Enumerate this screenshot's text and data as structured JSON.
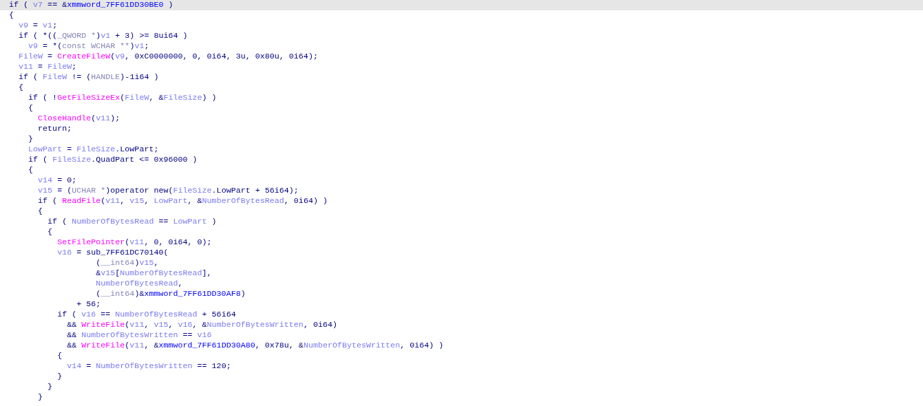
{
  "pseudocode": {
    "lines": [
      {
        "selected": true,
        "tokens": [
          {
            "kind": "k",
            "text": "if ( "
          },
          {
            "kind": "v",
            "text": "v7"
          },
          {
            "kind": "k",
            "text": " == &"
          },
          {
            "kind": "g",
            "text": "xmmword_7FF61DD30BE0"
          },
          {
            "kind": "k",
            "text": " )"
          }
        ]
      },
      {
        "selected": false,
        "tokens": [
          {
            "kind": "k",
            "text": "{"
          }
        ]
      },
      {
        "selected": false,
        "tokens": [
          {
            "kind": "v",
            "text": "  v9"
          },
          {
            "kind": "k",
            "text": " = "
          },
          {
            "kind": "v",
            "text": "v1"
          },
          {
            "kind": "k",
            "text": ";"
          }
        ]
      },
      {
        "selected": false,
        "tokens": [
          {
            "kind": "k",
            "text": "  if ( *(("
          },
          {
            "kind": "t",
            "text": "_QWORD *"
          },
          {
            "kind": "k",
            "text": ")"
          },
          {
            "kind": "v",
            "text": "v1"
          },
          {
            "kind": "k",
            "text": " + 3) >= 8ui64 )"
          }
        ]
      },
      {
        "selected": false,
        "tokens": [
          {
            "kind": "v",
            "text": "    v9"
          },
          {
            "kind": "k",
            "text": " = *("
          },
          {
            "kind": "t",
            "text": "const WCHAR **"
          },
          {
            "kind": "k",
            "text": ")"
          },
          {
            "kind": "v",
            "text": "v1"
          },
          {
            "kind": "k",
            "text": ";"
          }
        ]
      },
      {
        "selected": false,
        "tokens": [
          {
            "kind": "v",
            "text": "  FileW"
          },
          {
            "kind": "k",
            "text": " = "
          },
          {
            "kind": "f",
            "text": "CreateFileW"
          },
          {
            "kind": "k",
            "text": "("
          },
          {
            "kind": "v",
            "text": "v9"
          },
          {
            "kind": "k",
            "text": ", 0xC0000000, 0, 0i64, 3u, 0x80u, 0i64);"
          }
        ]
      },
      {
        "selected": false,
        "tokens": [
          {
            "kind": "v",
            "text": "  v11"
          },
          {
            "kind": "k",
            "text": " = "
          },
          {
            "kind": "v",
            "text": "FileW"
          },
          {
            "kind": "k",
            "text": ";"
          }
        ]
      },
      {
        "selected": false,
        "tokens": [
          {
            "kind": "k",
            "text": "  if ( "
          },
          {
            "kind": "v",
            "text": "FileW"
          },
          {
            "kind": "k",
            "text": " != ("
          },
          {
            "kind": "t",
            "text": "HANDLE"
          },
          {
            "kind": "k",
            "text": ")-1i64 )"
          }
        ]
      },
      {
        "selected": false,
        "tokens": [
          {
            "kind": "k",
            "text": "  {"
          }
        ]
      },
      {
        "selected": false,
        "tokens": [
          {
            "kind": "k",
            "text": "    if ( !"
          },
          {
            "kind": "f",
            "text": "GetFileSizeEx"
          },
          {
            "kind": "k",
            "text": "("
          },
          {
            "kind": "v",
            "text": "FileW"
          },
          {
            "kind": "k",
            "text": ", &"
          },
          {
            "kind": "v",
            "text": "FileSize"
          },
          {
            "kind": "k",
            "text": ") )"
          }
        ]
      },
      {
        "selected": false,
        "tokens": [
          {
            "kind": "k",
            "text": "    {"
          }
        ]
      },
      {
        "selected": false,
        "tokens": [
          {
            "kind": "f",
            "text": "      CloseHandle"
          },
          {
            "kind": "k",
            "text": "("
          },
          {
            "kind": "v",
            "text": "v11"
          },
          {
            "kind": "k",
            "text": ");"
          }
        ]
      },
      {
        "selected": false,
        "tokens": [
          {
            "kind": "k",
            "text": "      return;"
          }
        ]
      },
      {
        "selected": false,
        "tokens": [
          {
            "kind": "k",
            "text": "    }"
          }
        ]
      },
      {
        "selected": false,
        "tokens": [
          {
            "kind": "v",
            "text": "    LowPart"
          },
          {
            "kind": "k",
            "text": " = "
          },
          {
            "kind": "v",
            "text": "FileSize"
          },
          {
            "kind": "k",
            "text": ".LowPart;"
          }
        ]
      },
      {
        "selected": false,
        "tokens": [
          {
            "kind": "k",
            "text": "    if ( "
          },
          {
            "kind": "v",
            "text": "FileSize"
          },
          {
            "kind": "k",
            "text": ".QuadPart <= 0x96000 )"
          }
        ]
      },
      {
        "selected": false,
        "tokens": [
          {
            "kind": "k",
            "text": "    {"
          }
        ]
      },
      {
        "selected": false,
        "tokens": [
          {
            "kind": "v",
            "text": "      v14"
          },
          {
            "kind": "k",
            "text": " = 0;"
          }
        ]
      },
      {
        "selected": false,
        "tokens": [
          {
            "kind": "v",
            "text": "      v15"
          },
          {
            "kind": "k",
            "text": " = ("
          },
          {
            "kind": "t",
            "text": "UCHAR *"
          },
          {
            "kind": "k",
            "text": ")operator new("
          },
          {
            "kind": "v",
            "text": "FileSize"
          },
          {
            "kind": "k",
            "text": ".LowPart + 56i64);"
          }
        ]
      },
      {
        "selected": false,
        "tokens": [
          {
            "kind": "k",
            "text": "      if ( "
          },
          {
            "kind": "f",
            "text": "ReadFile"
          },
          {
            "kind": "k",
            "text": "("
          },
          {
            "kind": "v",
            "text": "v11"
          },
          {
            "kind": "k",
            "text": ", "
          },
          {
            "kind": "v",
            "text": "v15"
          },
          {
            "kind": "k",
            "text": ", "
          },
          {
            "kind": "v",
            "text": "LowPart"
          },
          {
            "kind": "k",
            "text": ", &"
          },
          {
            "kind": "v",
            "text": "NumberOfBytesRead"
          },
          {
            "kind": "k",
            "text": ", 0i64) )"
          }
        ]
      },
      {
        "selected": false,
        "tokens": [
          {
            "kind": "k",
            "text": "      {"
          }
        ]
      },
      {
        "selected": false,
        "tokens": [
          {
            "kind": "k",
            "text": "        if ( "
          },
          {
            "kind": "v",
            "text": "NumberOfBytesRead"
          },
          {
            "kind": "k",
            "text": " == "
          },
          {
            "kind": "v",
            "text": "LowPart"
          },
          {
            "kind": "k",
            "text": " )"
          }
        ]
      },
      {
        "selected": false,
        "tokens": [
          {
            "kind": "k",
            "text": "        {"
          }
        ]
      },
      {
        "selected": false,
        "tokens": [
          {
            "kind": "f",
            "text": "          SetFilePointer"
          },
          {
            "kind": "k",
            "text": "("
          },
          {
            "kind": "v",
            "text": "v11"
          },
          {
            "kind": "k",
            "text": ", 0, 0i64, 0);"
          }
        ]
      },
      {
        "selected": false,
        "tokens": [
          {
            "kind": "v",
            "text": "          v16"
          },
          {
            "kind": "k",
            "text": " = sub_7FF61DC70140("
          }
        ]
      },
      {
        "selected": false,
        "tokens": [
          {
            "kind": "k",
            "text": "                  ("
          },
          {
            "kind": "t",
            "text": "__int64"
          },
          {
            "kind": "k",
            "text": ")"
          },
          {
            "kind": "v",
            "text": "v15"
          },
          {
            "kind": "k",
            "text": ","
          }
        ]
      },
      {
        "selected": false,
        "tokens": [
          {
            "kind": "k",
            "text": "                  &"
          },
          {
            "kind": "v",
            "text": "v15"
          },
          {
            "kind": "k",
            "text": "["
          },
          {
            "kind": "v",
            "text": "NumberOfBytesRead"
          },
          {
            "kind": "k",
            "text": "],"
          }
        ]
      },
      {
        "selected": false,
        "tokens": [
          {
            "kind": "v",
            "text": "                  NumberOfBytesRead"
          },
          {
            "kind": "k",
            "text": ","
          }
        ]
      },
      {
        "selected": false,
        "tokens": [
          {
            "kind": "k",
            "text": "                  ("
          },
          {
            "kind": "t",
            "text": "__int64"
          },
          {
            "kind": "k",
            "text": ")&"
          },
          {
            "kind": "g",
            "text": "xmmword_7FF61DD30AF8"
          },
          {
            "kind": "k",
            "text": ")"
          }
        ]
      },
      {
        "selected": false,
        "tokens": [
          {
            "kind": "k",
            "text": "              + 56;"
          }
        ]
      },
      {
        "selected": false,
        "tokens": [
          {
            "kind": "k",
            "text": "          if ( "
          },
          {
            "kind": "v",
            "text": "v16"
          },
          {
            "kind": "k",
            "text": " == "
          },
          {
            "kind": "v",
            "text": "NumberOfBytesRead"
          },
          {
            "kind": "k",
            "text": " + 56i64"
          }
        ]
      },
      {
        "selected": false,
        "tokens": [
          {
            "kind": "k",
            "text": "            && "
          },
          {
            "kind": "f",
            "text": "WriteFile"
          },
          {
            "kind": "k",
            "text": "("
          },
          {
            "kind": "v",
            "text": "v11"
          },
          {
            "kind": "k",
            "text": ", "
          },
          {
            "kind": "v",
            "text": "v15"
          },
          {
            "kind": "k",
            "text": ", "
          },
          {
            "kind": "v",
            "text": "v16"
          },
          {
            "kind": "k",
            "text": ", &"
          },
          {
            "kind": "v",
            "text": "NumberOfBytesWritten"
          },
          {
            "kind": "k",
            "text": ", 0i64)"
          }
        ]
      },
      {
        "selected": false,
        "tokens": [
          {
            "kind": "k",
            "text": "            && "
          },
          {
            "kind": "v",
            "text": "NumberOfBytesWritten"
          },
          {
            "kind": "k",
            "text": " == "
          },
          {
            "kind": "v",
            "text": "v16"
          }
        ]
      },
      {
        "selected": false,
        "tokens": [
          {
            "kind": "k",
            "text": "            && "
          },
          {
            "kind": "f",
            "text": "WriteFile"
          },
          {
            "kind": "k",
            "text": "("
          },
          {
            "kind": "v",
            "text": "v11"
          },
          {
            "kind": "k",
            "text": ", &"
          },
          {
            "kind": "g",
            "text": "xmmword_7FF61DD30A80"
          },
          {
            "kind": "k",
            "text": ", 0x78u, &"
          },
          {
            "kind": "v",
            "text": "NumberOfBytesWritten"
          },
          {
            "kind": "k",
            "text": ", 0i64) )"
          }
        ]
      },
      {
        "selected": false,
        "tokens": [
          {
            "kind": "k",
            "text": "          {"
          }
        ]
      },
      {
        "selected": false,
        "tokens": [
          {
            "kind": "v",
            "text": "            v14"
          },
          {
            "kind": "k",
            "text": " = "
          },
          {
            "kind": "v",
            "text": "NumberOfBytesWritten"
          },
          {
            "kind": "k",
            "text": " == 120;"
          }
        ]
      },
      {
        "selected": false,
        "tokens": [
          {
            "kind": "k",
            "text": "          }"
          }
        ]
      },
      {
        "selected": false,
        "tokens": [
          {
            "kind": "k",
            "text": "        }"
          }
        ]
      },
      {
        "selected": false,
        "tokens": [
          {
            "kind": "k",
            "text": "      }"
          }
        ]
      }
    ]
  }
}
